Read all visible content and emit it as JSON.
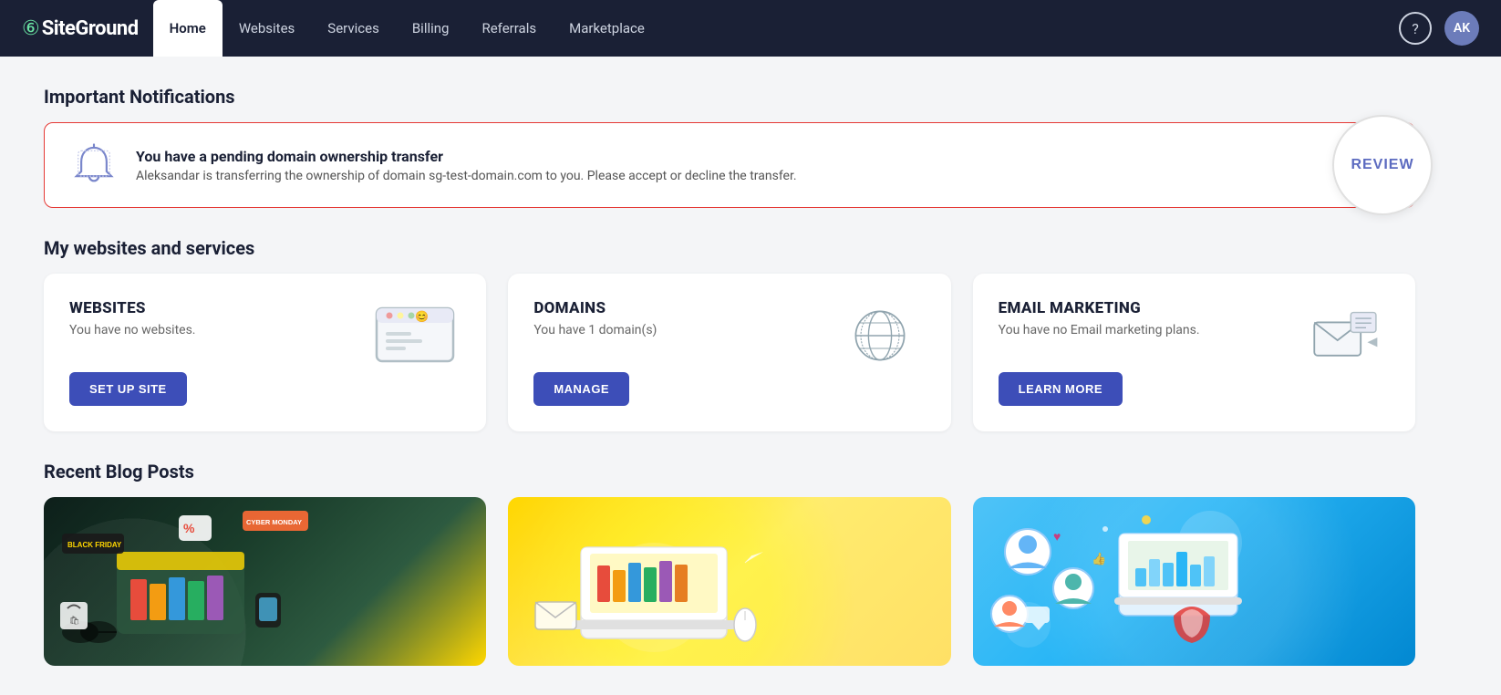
{
  "navbar": {
    "logo_text": "SiteGround",
    "nav_items": [
      {
        "label": "Home",
        "active": true
      },
      {
        "label": "Websites",
        "active": false
      },
      {
        "label": "Services",
        "active": false
      },
      {
        "label": "Billing",
        "active": false
      },
      {
        "label": "Referrals",
        "active": false
      },
      {
        "label": "Marketplace",
        "active": false
      }
    ],
    "help_label": "?",
    "user_initials": "AK"
  },
  "notifications": {
    "section_title": "Important Notifications",
    "card": {
      "title": "You have a pending domain ownership transfer",
      "description": "Aleksandar is transferring the ownership of domain sg-test-domain.com to you. Please accept or decline the transfer.",
      "review_btn": "REVIEW"
    }
  },
  "services": {
    "section_title": "My websites and services",
    "cards": [
      {
        "title": "WEBSITES",
        "description": "You have no websites.",
        "button_label": "SET UP SITE"
      },
      {
        "title": "DOMAINS",
        "description": "You have 1 domain(s)",
        "button_label": "MANAGE"
      },
      {
        "title": "EMAIL MARKETING",
        "description": "You have no Email marketing plans.",
        "button_label": "LEARN MORE"
      }
    ]
  },
  "blog": {
    "section_title": "Recent Blog Posts"
  }
}
